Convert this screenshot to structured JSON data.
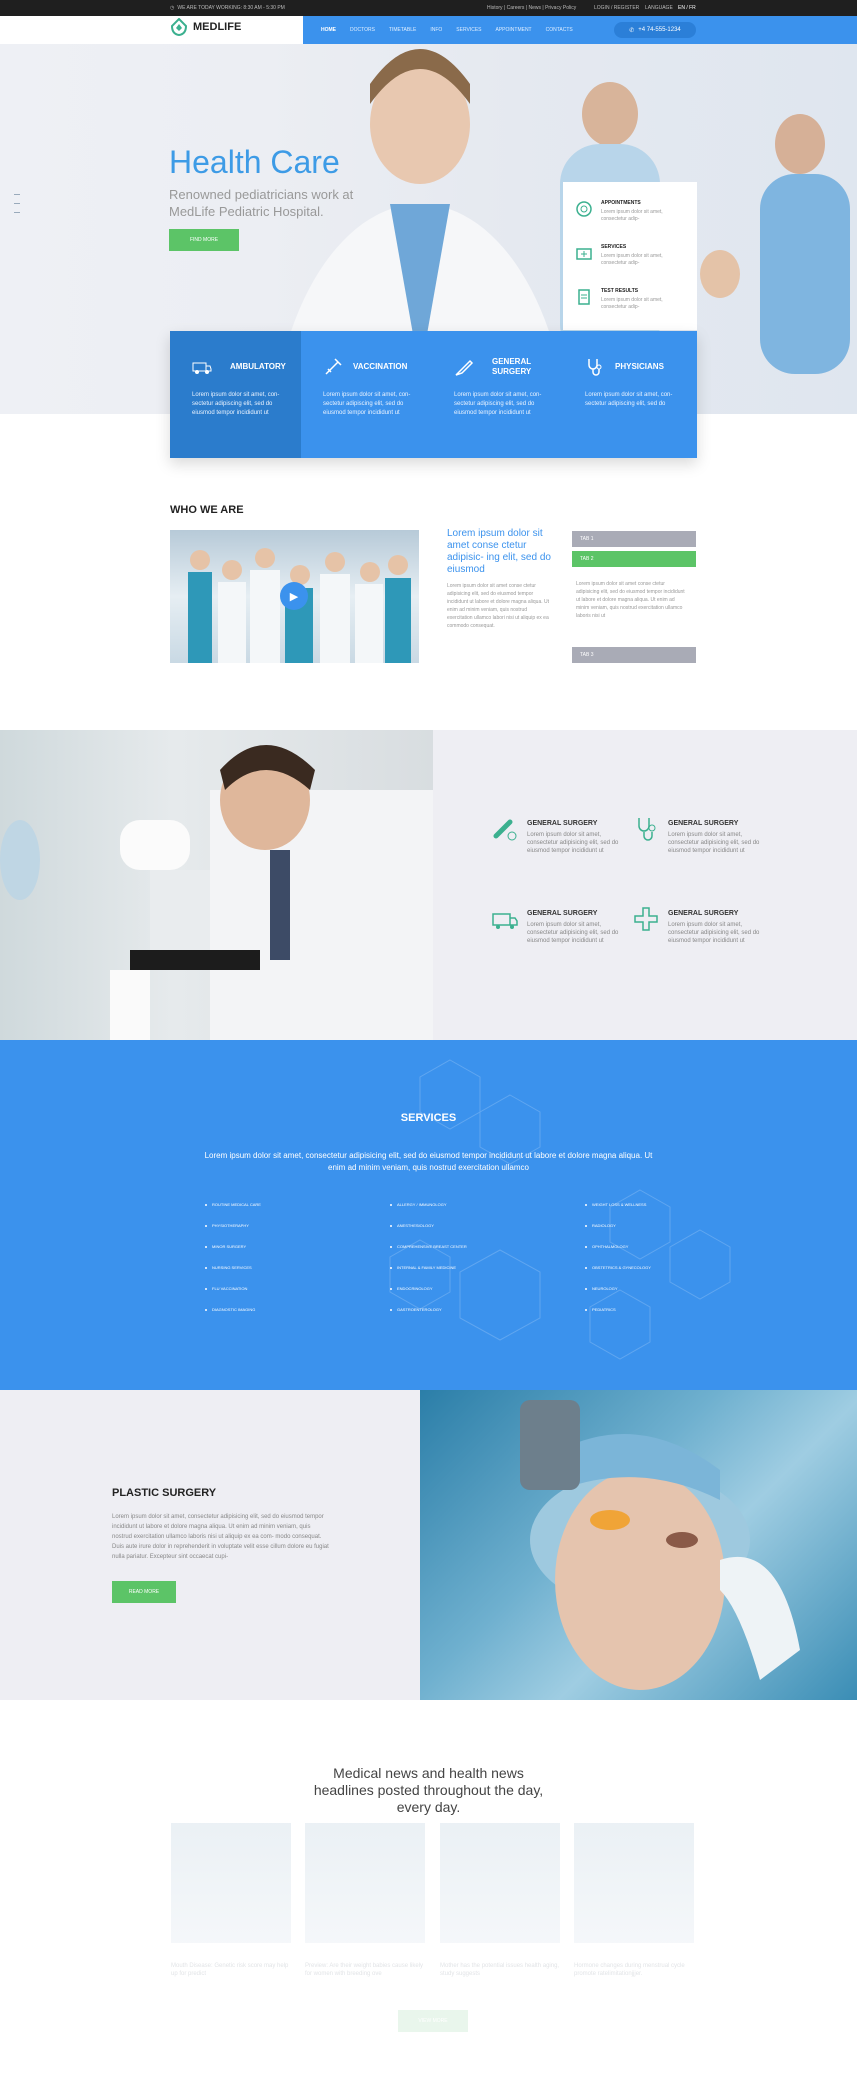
{
  "topbar": {
    "hours": "WE ARE TODAY WORKING: 8:30 AM - 5:30 PM",
    "links": "History | Careers | News | Privacy Policy",
    "login": "LOGIN / REGISTER",
    "language_label": "LANGUAGE",
    "language_value": "EN / FR"
  },
  "header": {
    "logo": "MEDLIFE",
    "nav": [
      "HOME",
      "DOCTORS",
      "TIMETABLE",
      "INFO",
      "SERVICES",
      "APPOINTMENT",
      "CONTACTS"
    ],
    "phone": "+4 74-555-1234"
  },
  "hero": {
    "title": "Health Care",
    "subtitle": "Renowned pediatricians work at MedLife Pediatric Hospital.",
    "button": "FIND MORE"
  },
  "sidebox": [
    {
      "title": "APPOINTMENTS",
      "text": "Lorem ipsum dolor sit amet, consectetur adip-"
    },
    {
      "title": "SERVICES",
      "text": "Lorem ipsum dolor sit amet, consectetur adip-"
    },
    {
      "title": "TEST RESULTS",
      "text": "Lorem ipsum dolor sit amet, consectetur adip-"
    }
  ],
  "features": [
    {
      "title": "AMBULATORY",
      "text": "Lorem ipsum dolor sit amet, con- sectetur adipiscing elit, sed do eiusmod tempor incididunt ut",
      "icon": "ambulance-icon"
    },
    {
      "title": "VACCINATION",
      "text": "Lorem ipsum dolor sit amet, con- sectetur adipiscing elit, sed do eiusmod tempor incididunt ut",
      "icon": "syringe-icon"
    },
    {
      "title": "GENERAL SURGERY",
      "text": "Lorem ipsum dolor sit amet, con- sectetur adipiscing elit, sed do eiusmod tempor incididunt ut",
      "icon": "scalpel-icon"
    },
    {
      "title": "PHYSICIANS",
      "text": "Lorem ipsum dolor sit amet, con- sectetur adipiscing elit, sed do",
      "icon": "stethoscope-icon"
    }
  ],
  "who": {
    "heading": "WHO WE ARE",
    "title": "Lorem ipsum dolor sit amet conse ctetur adipisic- ing elit, sed do eiusmod",
    "text": "Lorem ipsum dolor sit amet conse ctetur adipisicing elit, sed do eiusmod tempor incididunt ut labore et dolore magna aliqua. Ut enim ad minim veniam, quis nostrud exercitation ullamco labori nisi ut aliquip ex ea commodo consequat.",
    "tabs": [
      "TAB 1",
      "TAB 2",
      "TAB 3"
    ],
    "tab_text": "Lorem ipsum dolor sit amet conse ctetur adipisicing elit, sed do eiusmod tempor incididunt ut labore et dolore magna aliqua. Ut enim ad minim veniam, quis nostrud exercitation ullamco laboris nisi ut"
  },
  "surgery_grid": [
    {
      "title": "GENERAL SURGERY",
      "text": "Lorem ipsum dolor sit amet, consectetur adipisicing elit, sed do eiusmod tempor incididunt ut"
    },
    {
      "title": "GENERAL SURGERY",
      "text": "Lorem ipsum dolor sit amet, consectetur adipisicing elit, sed do eiusmod tempor incididunt ut"
    },
    {
      "title": "GENERAL SURGERY",
      "text": "Lorem ipsum dolor sit amet, consectetur adipisicing elit, sed do eiusmod tempor incididunt ut"
    },
    {
      "title": "GENERAL SURGERY",
      "text": "Lorem ipsum dolor sit amet, consectetur adipisicing elit, sed do eiusmod tempor incididunt ut"
    }
  ],
  "services": {
    "title": "SERVICES",
    "intro": "Lorem ipsum dolor sit amet, consectetur adipisicing elit, sed do eiusmod tempor incididunt ut labore et dolore magna aliqua. Ut enim ad minim veniam, quis nostrud exercitation ullamco",
    "col1": [
      "ROUTINE MEDICAL CARE",
      "PHYSIOTHERAPHY",
      "MINOR SURGERY",
      "NURSING SERVICES",
      "FLU VACCINATION",
      "DIAGNOSTIC IMAGING"
    ],
    "col2": [
      "ALLERGY / IMMUNOLOGY",
      "ANESTHESIOLOGY",
      "COMPREHENSIVE BREAST CENTER",
      "INTERNAL & FAMILY MEDICINE",
      "ENDOCRINOLOGY",
      "GASTROENTEROLOGY"
    ],
    "col3": [
      "WEIGHT LOSS & WELLNESS",
      "RADIOLOGY",
      "OPHTHALMOLOGY",
      "OBSTETRICS & GYNECOLOGY",
      "NEUROLOGY",
      "PEDIATRICS"
    ]
  },
  "plastic": {
    "title": "PLASTIC SURGERY",
    "text": "Lorem ipsum dolor sit amet, consectetur adipisicing elit, sed do eiusmod tempor incididunt ut labore et dolore magna aliqua. Ut enim ad minim veniam, quis nostrud exercitation ullamco laboris nisi ut aliquip ex ea com- modo consequat. Duis aute irure dolor in reprehenderit in voluptate velit esse cillum dolore eu fugiat nulla pariatur. Excepteur sint occaecat cupi-",
    "button": "READ MORE"
  },
  "news": {
    "title": "Medical news and health news headlines posted throughout the day, every day.",
    "items": [
      "Mouth Disease: Genetic risk score may help up for predict",
      "Preview: Are their weight babies cause likely for women with breeding ove",
      "Mother has the potential issues health aging, study suggests",
      "Hormone changes during menstrual cycle promote ratelimitationjjjer."
    ],
    "button": "VIEW MORE"
  },
  "colors": {
    "accent": "#3b92ed",
    "green": "#5cc467",
    "dark": "#1f1f1f"
  }
}
